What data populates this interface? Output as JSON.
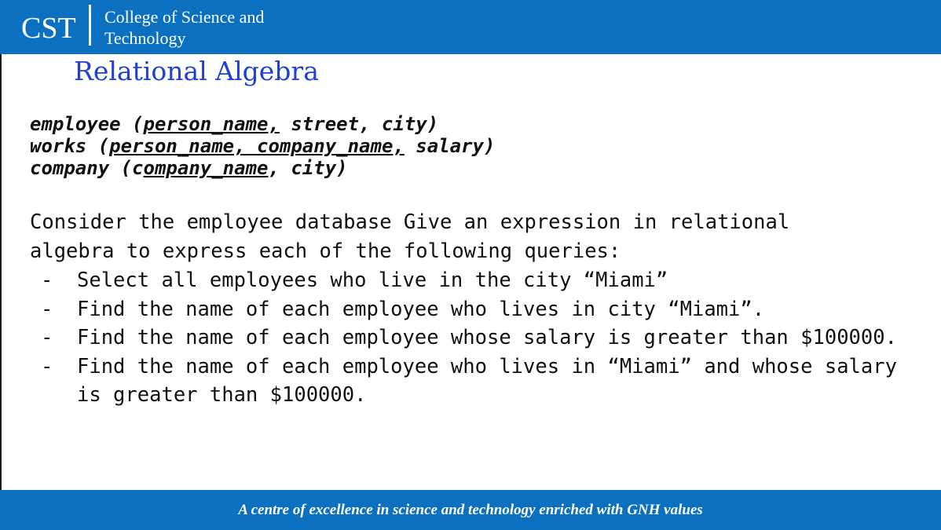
{
  "header": {
    "logo_text": "CST",
    "college_name_line1": "College of Science and",
    "college_name_line2": "Technology"
  },
  "slide": {
    "title": "Relational Algebra"
  },
  "schema": [
    {
      "name": "employee",
      "open": " (",
      "pk1": "person_name,",
      "rest": " street, city)"
    },
    {
      "name": "works",
      "open": " (",
      "pk1": "person_name,",
      "sep": " ",
      "pk2": "company_name,",
      "rest": " salary)"
    },
    {
      "name": "company",
      "open": " (c",
      "pk1": "ompany_name",
      "rest": ", city)"
    }
  ],
  "intro": {
    "line1": "Consider the employee database Give an expression in relational",
    "line2": "algebra to express each of the following queries:"
  },
  "queries": [
    "Select all employees who live in the city “Miami”",
    "Find the name of each employee who lives in city “Miami”.",
    "Find the name of each employee whose salary is greater than $100000.",
    "Find the name of each employee who lives in “Miami” and whose salary is greater than $100000."
  ],
  "bullet_char": "-",
  "footer": {
    "tagline": "A centre of excellence in science and technology enriched with GNH values"
  },
  "colors": {
    "brand_blue": "#0b70c0",
    "title_blue": "#1f3fd6"
  }
}
